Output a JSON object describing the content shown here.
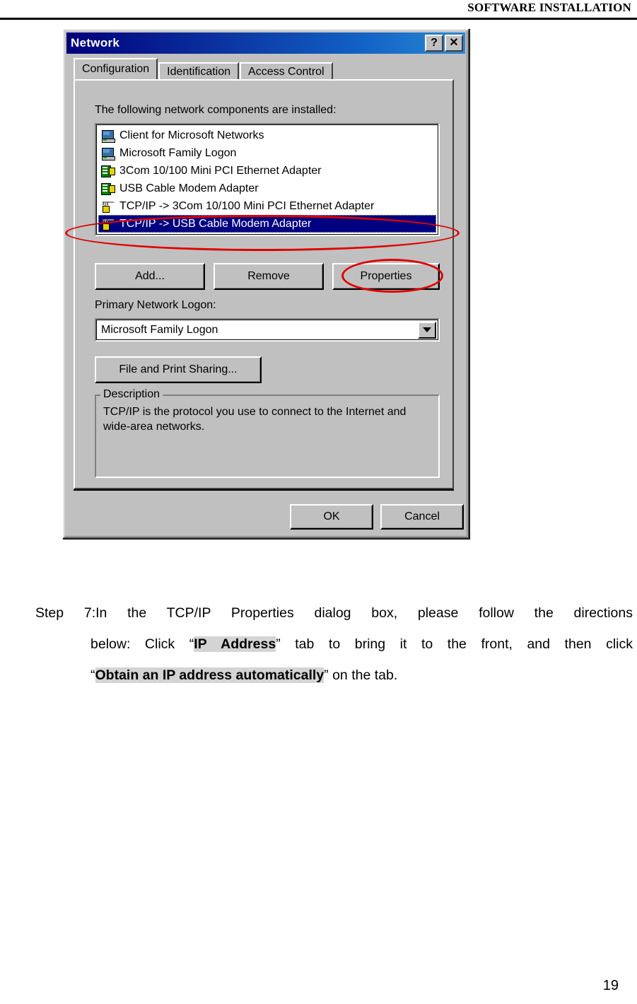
{
  "page": {
    "header_title": "SOFTWARE INSTALLATION",
    "page_number": "19"
  },
  "dialog": {
    "title": "Network",
    "titlebar_buttons": [
      {
        "name": "help-button",
        "label": "?"
      },
      {
        "name": "close-button",
        "label": "✕"
      }
    ],
    "tabs": [
      {
        "label": "Configuration",
        "active": true
      },
      {
        "label": "Identification",
        "active": false
      },
      {
        "label": "Access Control",
        "active": false
      }
    ],
    "components_label": "The following network components are installed:",
    "components": [
      {
        "label": "Client for Microsoft Networks",
        "icon": "monitor-icon",
        "selected": false
      },
      {
        "label": "Microsoft Family Logon",
        "icon": "monitor-icon",
        "selected": false
      },
      {
        "label": "3Com 10/100 Mini PCI Ethernet Adapter",
        "icon": "adapter-icon",
        "selected": false
      },
      {
        "label": "USB Cable Modem Adapter",
        "icon": "adapter-icon",
        "selected": false
      },
      {
        "label": "TCP/IP -> 3Com 10/100 Mini PCI Ethernet Adapter",
        "icon": "protocol-icon",
        "selected": false
      },
      {
        "label": "TCP/IP -> USB Cable Modem Adapter",
        "icon": "protocol-icon",
        "selected": true
      }
    ],
    "buttons": {
      "add": "Add...",
      "remove": "Remove",
      "properties": "Properties",
      "file_print_sharing": "File and Print Sharing...",
      "ok": "OK",
      "cancel": "Cancel"
    },
    "primary_logon": {
      "label": "Primary Network Logon:",
      "value": "Microsoft Family Logon"
    },
    "description": {
      "legend": "Description",
      "text": "TCP/IP is the protocol you use to connect to the Internet and wide-area networks."
    },
    "annotations": [
      {
        "name": "annotation-ellipse-selected-protocol",
        "color": "#e00000"
      },
      {
        "name": "annotation-ellipse-properties-button",
        "color": "#e00000"
      }
    ]
  },
  "body": {
    "step_label": "Step 7:",
    "line1": "In  the  TCP/IP  Properties  dialog  box,  please  follow  the  directions",
    "line2_a": "below: Click “",
    "line2_hl": "IP Address",
    "line2_b": "” tab to bring it to the front, and then click",
    "line3_a": "“",
    "line3_hl": "Obtain an IP address automatically",
    "line3_b": "” on the tab."
  }
}
